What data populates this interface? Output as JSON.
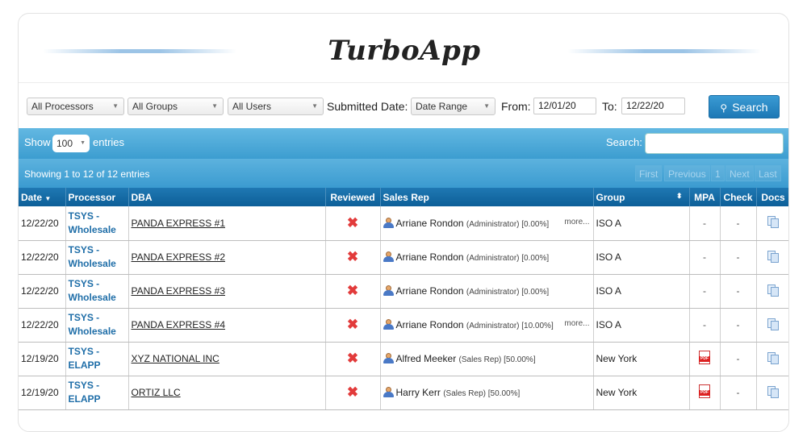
{
  "app": {
    "title": "TurboApp"
  },
  "filters": {
    "processor": "All Processors",
    "group": "All Groups",
    "user": "All Users",
    "submitted_label": "Submitted Date:",
    "date_type": "Date Range",
    "from_label": "From:",
    "from_value": "12/01/20",
    "to_label": "To:",
    "to_value": "12/22/20",
    "search_button": "Search"
  },
  "table_controls": {
    "show_label": "Show",
    "entries_label": "entries",
    "page_length": "100",
    "search_label": "Search:",
    "search_value": "",
    "info": "Showing 1 to 12 of 12 entries",
    "pager": {
      "first": "First",
      "previous": "Previous",
      "current": "1",
      "next": "Next",
      "last": "Last"
    }
  },
  "columns": [
    "Date",
    "Processor",
    "DBA",
    "Reviewed",
    "Sales Rep",
    "Group",
    "MPA",
    "Check",
    "Docs"
  ],
  "rows": [
    {
      "date": "12/22/20",
      "proc1": "TSYS -",
      "proc2": "Wholesale",
      "dba": "PANDA EXPRESS #1",
      "rep": "Arriane Rondon",
      "role": "(Administrator) [0.00%]",
      "more": "more...",
      "group": "ISO A",
      "mpa": "-",
      "check": "-"
    },
    {
      "date": "12/22/20",
      "proc1": "TSYS -",
      "proc2": "Wholesale",
      "dba": "PANDA EXPRESS #2",
      "rep": "Arriane Rondon",
      "role": "(Administrator) [0.00%]",
      "more": "",
      "group": "ISO A",
      "mpa": "-",
      "check": "-"
    },
    {
      "date": "12/22/20",
      "proc1": "TSYS -",
      "proc2": "Wholesale",
      "dba": "PANDA EXPRESS #3",
      "rep": "Arriane Rondon",
      "role": "(Administrator) [0.00%]",
      "more": "",
      "group": "ISO A",
      "mpa": "-",
      "check": "-"
    },
    {
      "date": "12/22/20",
      "proc1": "TSYS -",
      "proc2": "Wholesale",
      "dba": "PANDA EXPRESS #4",
      "rep": "Arriane Rondon",
      "role": "(Administrator) [10.00%]",
      "more": "more...",
      "group": "ISO A",
      "mpa": "-",
      "check": "-"
    },
    {
      "date": "12/19/20",
      "proc1": "TSYS -",
      "proc2": "ELAPP",
      "dba": "XYZ NATIONAL INC",
      "rep": "Alfred Meeker",
      "role": "(Sales Rep) [50.00%]",
      "more": "",
      "group": "New York",
      "mpa": "pdf",
      "check": "-"
    },
    {
      "date": "12/19/20",
      "proc1": "TSYS -",
      "proc2": "ELAPP",
      "dba": "ORTIZ LLC",
      "rep": "Harry Kerr",
      "role": "(Sales Rep) [50.00%]",
      "more": "",
      "group": "New York",
      "mpa": "pdf",
      "check": "-"
    }
  ],
  "icons": {
    "reviewed": "x-mark-icon",
    "rep": "user-icon",
    "docs": "documents-icon",
    "mpa": "pdf-icon"
  },
  "colors": {
    "header_bar": "#1f78b3",
    "accent": "#3c9dd0",
    "link": "#1f6ea8",
    "reject": "#e23b3b"
  }
}
